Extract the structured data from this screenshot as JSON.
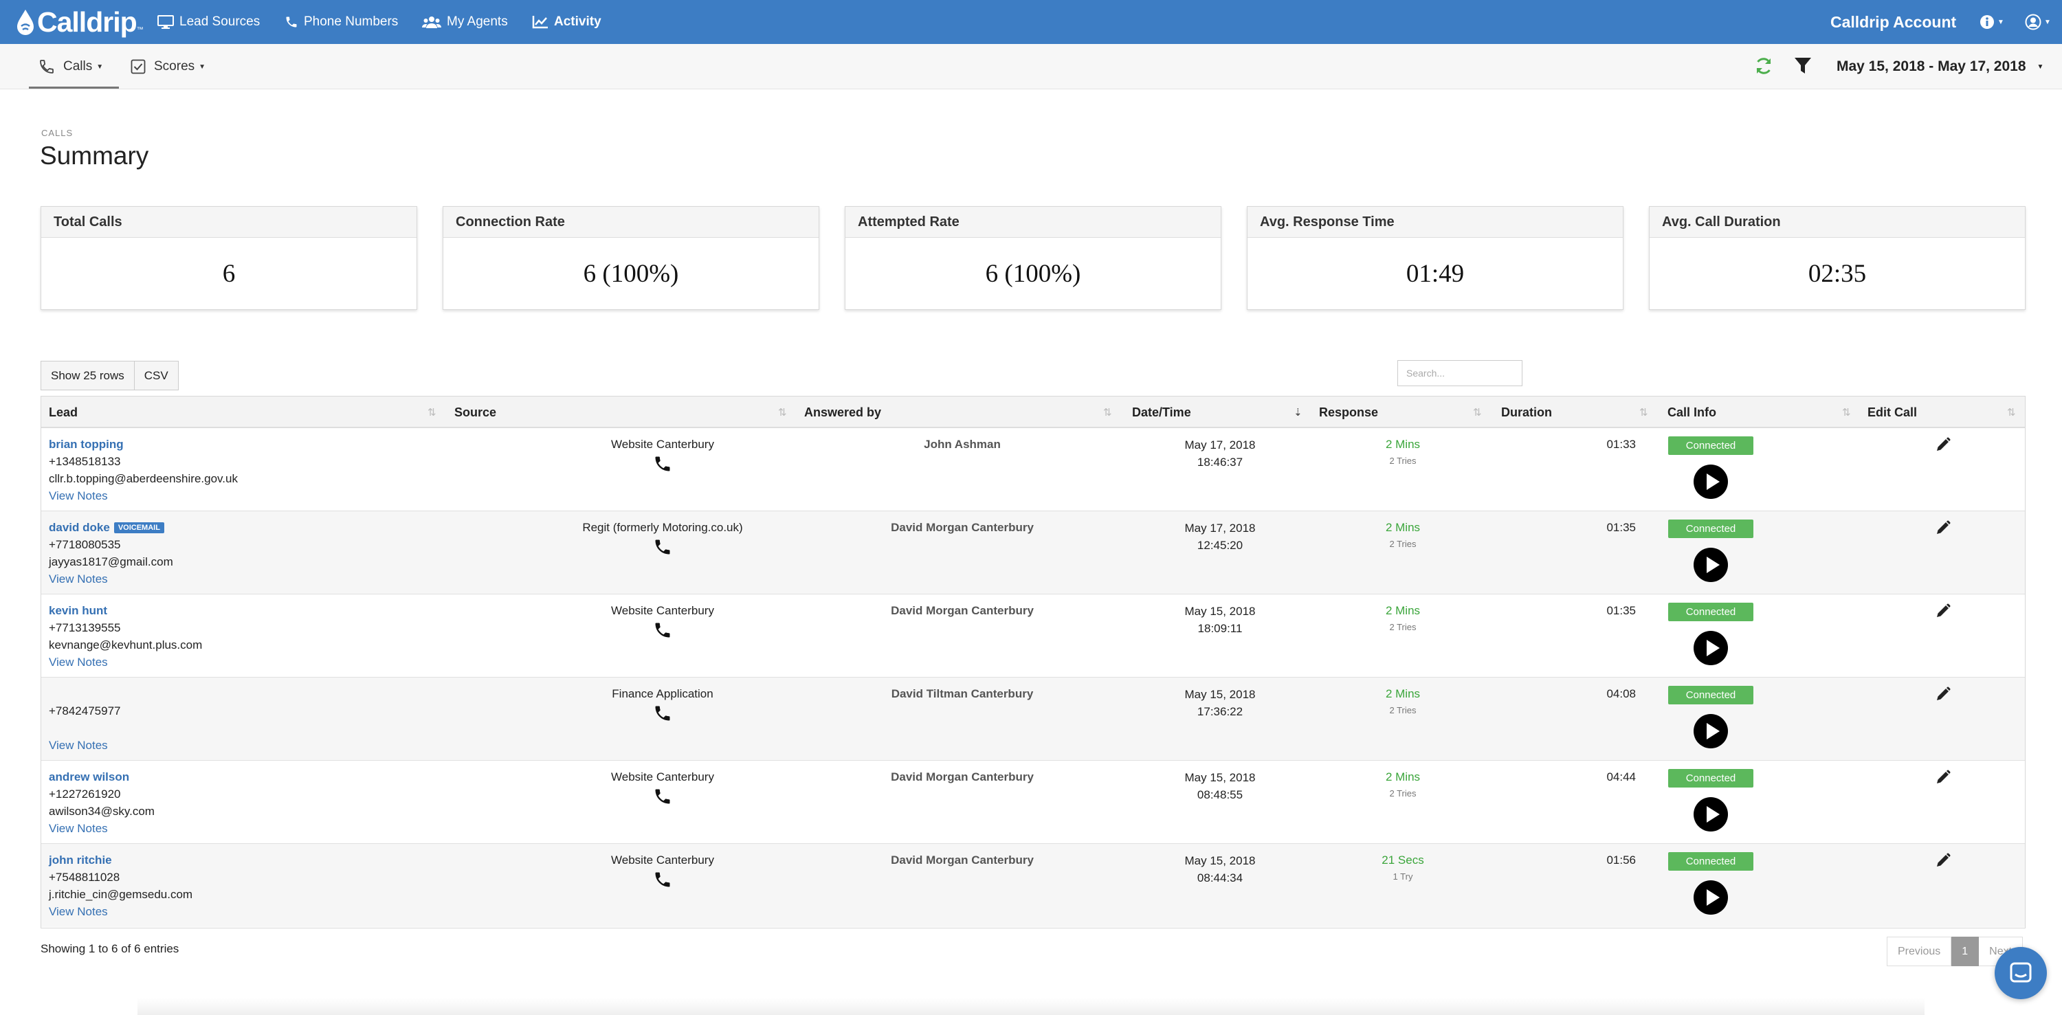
{
  "navbar": {
    "brand": "Calldrip",
    "brand_tm": "™",
    "items": [
      {
        "label": "Lead Sources",
        "icon": "monitor-icon"
      },
      {
        "label": "Phone Numbers",
        "icon": "phone-icon"
      },
      {
        "label": "My Agents",
        "icon": "users-icon"
      },
      {
        "label": "Activity",
        "icon": "chart-line-icon",
        "active": true
      }
    ],
    "account_label": "Calldrip Account",
    "accent_color": "#3d7dc4"
  },
  "subbar": {
    "tabs": [
      {
        "label": "Calls",
        "icon": "phone-outline-icon",
        "active": true
      },
      {
        "label": "Scores",
        "icon": "checkbox-icon"
      }
    ],
    "date_range": "May 15, 2018 - May 17, 2018"
  },
  "page": {
    "eyebrow": "CALLS",
    "title": "Summary"
  },
  "stats": [
    {
      "label": "Total Calls",
      "value": "6"
    },
    {
      "label": "Connection Rate",
      "value": "6 (100%)"
    },
    {
      "label": "Attempted Rate",
      "value": "6 (100%)"
    },
    {
      "label": "Avg. Response Time",
      "value": "01:49"
    },
    {
      "label": "Avg. Call Duration",
      "value": "02:35"
    }
  ],
  "table_controls": {
    "show_rows": "Show 25 rows",
    "csv": "CSV",
    "search_placeholder": "Search..."
  },
  "table": {
    "columns": [
      "Lead",
      "Source",
      "Answered by",
      "Date/Time",
      "Response",
      "Duration",
      "Call Info",
      "Edit Call"
    ],
    "sorted_column": "Date/Time",
    "rows": [
      {
        "name": "brian topping",
        "voicemail": "",
        "phone": "+1348518133",
        "email": "cllr.b.topping@aberdeenshire.gov.uk",
        "notes": "View Notes",
        "source": "Website Canterbury",
        "agent": "John Ashman",
        "date": "May 17, 2018",
        "time": "18:46:37",
        "response": "2 Mins",
        "tries": "2 Tries",
        "duration": "01:33",
        "status": "Connected"
      },
      {
        "name": "david doke",
        "voicemail": "VOICEMAIL",
        "phone": "+7718080535",
        "email": "jayyas1817@gmail.com",
        "notes": "View Notes",
        "source": "Regit (formerly Motoring.co.uk)",
        "agent": "David Morgan Canterbury",
        "date": "May 17, 2018",
        "time": "12:45:20",
        "response": "2 Mins",
        "tries": "2 Tries",
        "duration": "01:35",
        "status": "Connected"
      },
      {
        "name": "kevin hunt",
        "voicemail": "",
        "phone": "+7713139555",
        "email": "kevnange@kevhunt.plus.com",
        "notes": "View Notes",
        "source": "Website Canterbury",
        "agent": "David Morgan Canterbury",
        "date": "May 15, 2018",
        "time": "18:09:11",
        "response": "2 Mins",
        "tries": "2 Tries",
        "duration": "01:35",
        "status": "Connected"
      },
      {
        "name": "",
        "voicemail": "",
        "phone": "+7842475977",
        "email": "",
        "notes": "View Notes",
        "source": "Finance Application",
        "agent": "David Tiltman Canterbury",
        "date": "May 15, 2018",
        "time": "17:36:22",
        "response": "2 Mins",
        "tries": "2 Tries",
        "duration": "04:08",
        "status": "Connected"
      },
      {
        "name": "andrew wilson",
        "voicemail": "",
        "phone": "+1227261920",
        "email": "awilson34@sky.com",
        "notes": "View Notes",
        "source": "Website Canterbury",
        "agent": "David Morgan Canterbury",
        "date": "May 15, 2018",
        "time": "08:48:55",
        "response": "2 Mins",
        "tries": "2 Tries",
        "duration": "04:44",
        "status": "Connected"
      },
      {
        "name": "john ritchie",
        "voicemail": "",
        "phone": "+7548811028",
        "email": "j.ritchie_cin@gemsedu.com",
        "notes": "View Notes",
        "source": "Website Canterbury",
        "agent": "David Morgan Canterbury",
        "date": "May 15, 2018",
        "time": "08:44:34",
        "response": "21 Secs",
        "tries": "1 Try",
        "duration": "01:56",
        "status": "Connected"
      }
    ]
  },
  "footer": {
    "showing": "Showing 1 to 6 of 6 entries",
    "prev": "Previous",
    "page": "1",
    "next": "Next"
  },
  "colors": {
    "success": "#5cb85c",
    "link": "#3570b3",
    "response_green": "#3aa53a"
  }
}
